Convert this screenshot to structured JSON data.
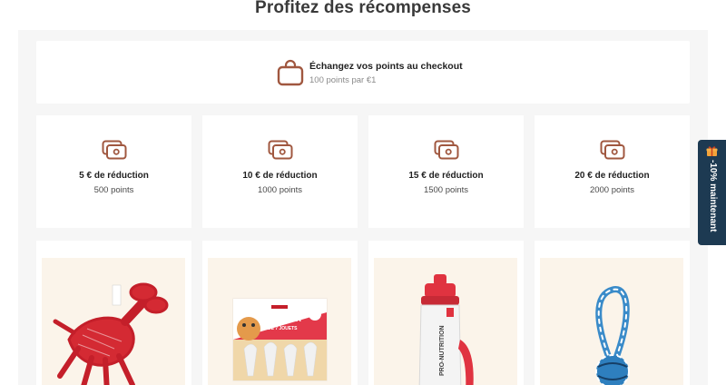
{
  "section": {
    "title": "Profitez des récompenses"
  },
  "checkout": {
    "title": "Échangez vos points au checkout",
    "subtitle": "100 points par €1",
    "icon": "shopping-bag-icon"
  },
  "rewards": [
    {
      "title": "5 € de réduction",
      "points": "500 points",
      "icon": "coupon-icon"
    },
    {
      "title": "10 € de réduction",
      "points": "1000 points",
      "icon": "coupon-icon"
    },
    {
      "title": "15 € de réduction",
      "points": "1500 points",
      "icon": "coupon-icon"
    },
    {
      "title": "20 € de réduction",
      "points": "2000 points",
      "icon": "coupon-icon"
    }
  ],
  "products": [
    {
      "icon": "lobster-rope-toy-image"
    },
    {
      "icon": "cat-toy-box-image",
      "box_title": "COFFRET",
      "box_sub": "DE 7 JOUETS"
    },
    {
      "icon": "water-bottle-image",
      "brand": "PRO-NUTRITION"
    },
    {
      "icon": "rope-ball-toy-image"
    }
  ],
  "side_tab": {
    "label": "-10% maintenant",
    "icon": "gift-icon"
  },
  "colors": {
    "accent": "#a0573f",
    "tab_bg": "#1d3a52",
    "panel_bg": "#f6f6f6",
    "image_bg": "#fbf4ea"
  }
}
